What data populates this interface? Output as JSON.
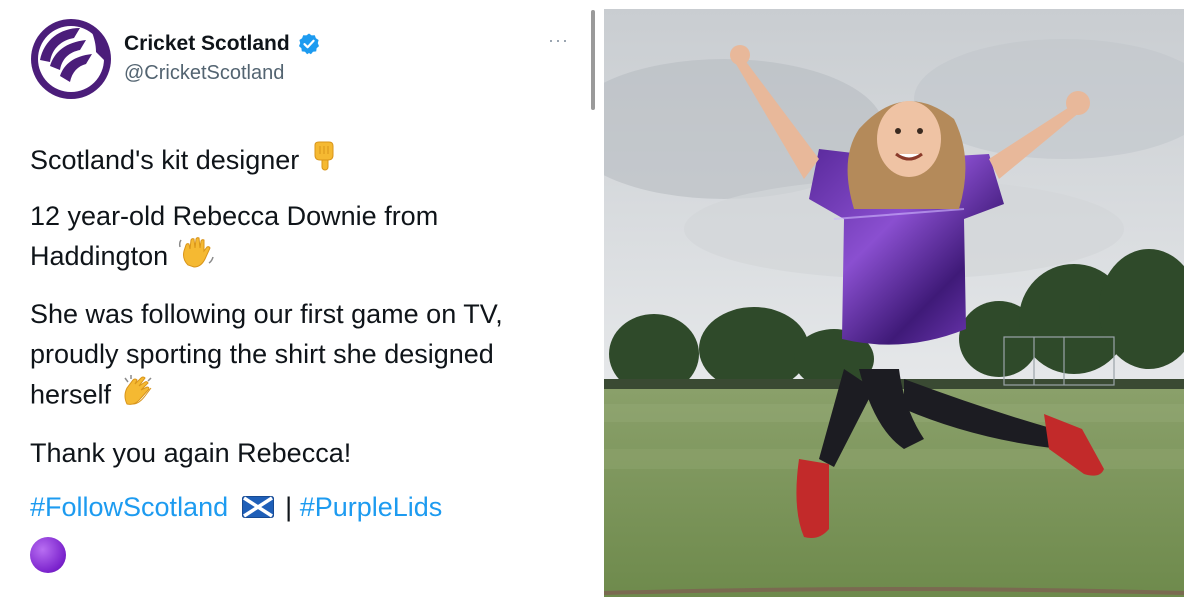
{
  "tweet": {
    "author": {
      "display_name": "Cricket Scotland",
      "handle": "@CricketScotland",
      "verified": true,
      "avatar_icon": "cricket-scotland-logo-icon"
    },
    "more_label": "···",
    "paragraphs": [
      {
        "text": "Scotland's kit designer",
        "emoji": "pointing-down-icon"
      },
      {
        "text": "12 year-old Rebecca Downie from Haddington",
        "emoji": "waving-hand-icon"
      },
      {
        "text": "She was following our first game on TV, proudly sporting the shirt she designed herself",
        "emoji": "clapping-hands-icon"
      },
      {
        "text": "Thank you again Rebecca!"
      }
    ],
    "hashtags": [
      "#FollowScotland",
      "#PurpleLids"
    ],
    "separator": "|",
    "trailing_emoji": "purple-circle-icon"
  },
  "photo": {
    "subject": "girl-jumping-in-purple-shirt"
  },
  "colors": {
    "link": "#1d9bf0",
    "text": "#0f1419",
    "secondary": "#536471",
    "brand_purple": "#4b1d7a",
    "verified": "#1d9bf0"
  }
}
